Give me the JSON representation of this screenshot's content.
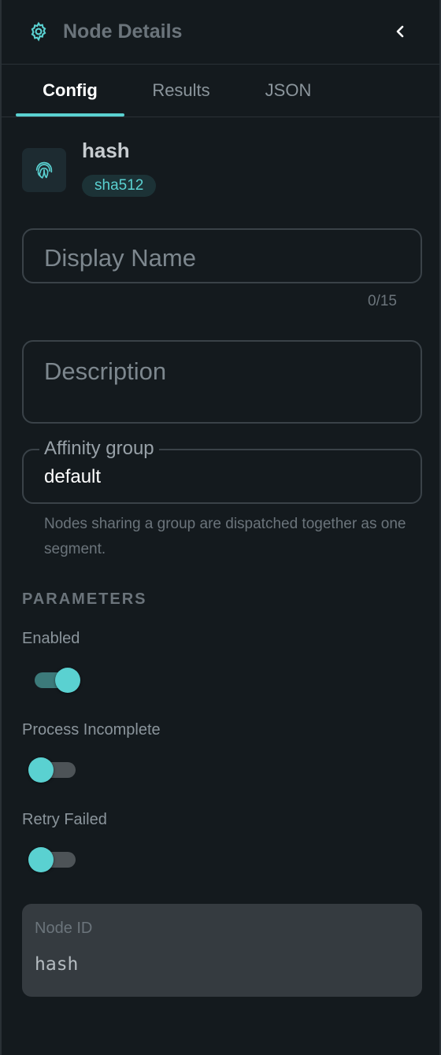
{
  "header": {
    "title": "Node Details",
    "icon": "gear-icon",
    "back_icon": "chevron-left-icon"
  },
  "tabs": [
    {
      "label": "Config",
      "active": true
    },
    {
      "label": "Results",
      "active": false
    },
    {
      "label": "JSON",
      "active": false
    }
  ],
  "node": {
    "name": "hash",
    "badge": "sha512",
    "icon": "fingerprint-icon"
  },
  "form": {
    "display_name": {
      "placeholder": "Display Name",
      "value": "",
      "counter": "0/15"
    },
    "description": {
      "placeholder": "Description",
      "value": ""
    },
    "affinity_group": {
      "label": "Affinity group",
      "value": "default",
      "helper": "Nodes sharing a group are dispatched together as one segment."
    }
  },
  "parameters": {
    "section_title": "PARAMETERS",
    "items": [
      {
        "label": "Enabled",
        "on": true
      },
      {
        "label": "Process Incomplete",
        "on": false
      },
      {
        "label": "Retry Failed",
        "on": false
      }
    ]
  },
  "node_id": {
    "label": "Node ID",
    "value": "hash"
  },
  "colors": {
    "accent": "#5ad1d1",
    "background": "#141a1e",
    "muted": "#6b747b"
  }
}
